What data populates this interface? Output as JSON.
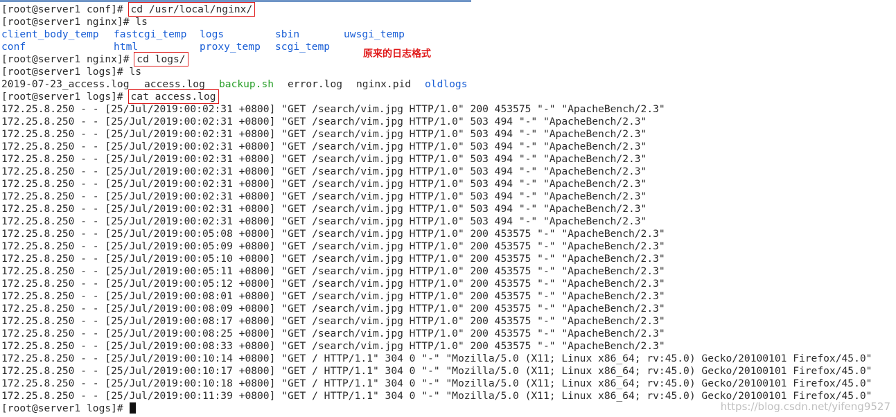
{
  "cmd1": {
    "prompt": "[root@server1 conf]# ",
    "command": "cd /usr/local/nginx/"
  },
  "cmd2": {
    "prompt": "[root@server1 nginx]# ",
    "command": "ls"
  },
  "ls1": {
    "row1": [
      "client_body_temp",
      "fastcgi_temp",
      "logs",
      "sbin",
      "uwsgi_temp"
    ],
    "row2": [
      "conf",
      "html",
      "proxy_temp",
      "scgi_temp"
    ]
  },
  "annotation": "原来的日志格式",
  "cmd3": {
    "prompt": "[root@server1 nginx]# ",
    "command": "cd logs/"
  },
  "cmd4": {
    "prompt": "[root@server1 logs]# ",
    "command": "ls"
  },
  "ls2": [
    "2019-07-23_access.log",
    "access.log",
    "backup.sh",
    "error.log",
    "nginx.pid",
    "oldlogs"
  ],
  "cmd5": {
    "prompt": "[root@server1 logs]# ",
    "command": "cat access.log"
  },
  "log_lines": [
    "172.25.8.250 - - [25/Jul/2019:00:02:31 +0800] \"GET /search/vim.jpg HTTP/1.0\" 200 453575 \"-\" \"ApacheBench/2.3\"",
    "172.25.8.250 - - [25/Jul/2019:00:02:31 +0800] \"GET /search/vim.jpg HTTP/1.0\" 503 494 \"-\" \"ApacheBench/2.3\"",
    "172.25.8.250 - - [25/Jul/2019:00:02:31 +0800] \"GET /search/vim.jpg HTTP/1.0\" 503 494 \"-\" \"ApacheBench/2.3\"",
    "172.25.8.250 - - [25/Jul/2019:00:02:31 +0800] \"GET /search/vim.jpg HTTP/1.0\" 503 494 \"-\" \"ApacheBench/2.3\"",
    "172.25.8.250 - - [25/Jul/2019:00:02:31 +0800] \"GET /search/vim.jpg HTTP/1.0\" 503 494 \"-\" \"ApacheBench/2.3\"",
    "172.25.8.250 - - [25/Jul/2019:00:02:31 +0800] \"GET /search/vim.jpg HTTP/1.0\" 503 494 \"-\" \"ApacheBench/2.3\"",
    "172.25.8.250 - - [25/Jul/2019:00:02:31 +0800] \"GET /search/vim.jpg HTTP/1.0\" 503 494 \"-\" \"ApacheBench/2.3\"",
    "172.25.8.250 - - [25/Jul/2019:00:02:31 +0800] \"GET /search/vim.jpg HTTP/1.0\" 503 494 \"-\" \"ApacheBench/2.3\"",
    "172.25.8.250 - - [25/Jul/2019:00:02:31 +0800] \"GET /search/vim.jpg HTTP/1.0\" 503 494 \"-\" \"ApacheBench/2.3\"",
    "172.25.8.250 - - [25/Jul/2019:00:02:31 +0800] \"GET /search/vim.jpg HTTP/1.0\" 503 494 \"-\" \"ApacheBench/2.3\"",
    "172.25.8.250 - - [25/Jul/2019:00:05:08 +0800] \"GET /search/vim.jpg HTTP/1.0\" 200 453575 \"-\" \"ApacheBench/2.3\"",
    "172.25.8.250 - - [25/Jul/2019:00:05:09 +0800] \"GET /search/vim.jpg HTTP/1.0\" 200 453575 \"-\" \"ApacheBench/2.3\"",
    "172.25.8.250 - - [25/Jul/2019:00:05:10 +0800] \"GET /search/vim.jpg HTTP/1.0\" 200 453575 \"-\" \"ApacheBench/2.3\"",
    "172.25.8.250 - - [25/Jul/2019:00:05:11 +0800] \"GET /search/vim.jpg HTTP/1.0\" 200 453575 \"-\" \"ApacheBench/2.3\"",
    "172.25.8.250 - - [25/Jul/2019:00:05:12 +0800] \"GET /search/vim.jpg HTTP/1.0\" 200 453575 \"-\" \"ApacheBench/2.3\"",
    "172.25.8.250 - - [25/Jul/2019:00:08:01 +0800] \"GET /search/vim.jpg HTTP/1.0\" 200 453575 \"-\" \"ApacheBench/2.3\"",
    "172.25.8.250 - - [25/Jul/2019:00:08:09 +0800] \"GET /search/vim.jpg HTTP/1.0\" 200 453575 \"-\" \"ApacheBench/2.3\"",
    "172.25.8.250 - - [25/Jul/2019:00:08:17 +0800] \"GET /search/vim.jpg HTTP/1.0\" 200 453575 \"-\" \"ApacheBench/2.3\"",
    "172.25.8.250 - - [25/Jul/2019:00:08:25 +0800] \"GET /search/vim.jpg HTTP/1.0\" 200 453575 \"-\" \"ApacheBench/2.3\"",
    "172.25.8.250 - - [25/Jul/2019:00:08:33 +0800] \"GET /search/vim.jpg HTTP/1.0\" 200 453575 \"-\" \"ApacheBench/2.3\"",
    "172.25.8.250 - - [25/Jul/2019:00:10:14 +0800] \"GET / HTTP/1.1\" 304 0 \"-\" \"Mozilla/5.0 (X11; Linux x86_64; rv:45.0) Gecko/20100101 Firefox/45.0\"",
    "172.25.8.250 - - [25/Jul/2019:00:10:17 +0800] \"GET / HTTP/1.1\" 304 0 \"-\" \"Mozilla/5.0 (X11; Linux x86_64; rv:45.0) Gecko/20100101 Firefox/45.0\"",
    "172.25.8.250 - - [25/Jul/2019:00:10:18 +0800] \"GET / HTTP/1.1\" 304 0 \"-\" \"Mozilla/5.0 (X11; Linux x86_64; rv:45.0) Gecko/20100101 Firefox/45.0\"",
    "172.25.8.250 - - [25/Jul/2019:00:11:39 +0800] \"GET / HTTP/1.1\" 304 0 \"-\" \"Mozilla/5.0 (X11; Linux x86_64; rv:45.0) Gecko/20100101 Firefox/45.0\""
  ],
  "final_prompt": "[root@server1 logs]# ",
  "watermark": "https://blog.csdn.net/yifeng9527",
  "colors": {
    "directory": "#1a5fd6",
    "executable": "#2aa02a",
    "highlight_box": "#e02020",
    "annotation": "#e01818"
  }
}
